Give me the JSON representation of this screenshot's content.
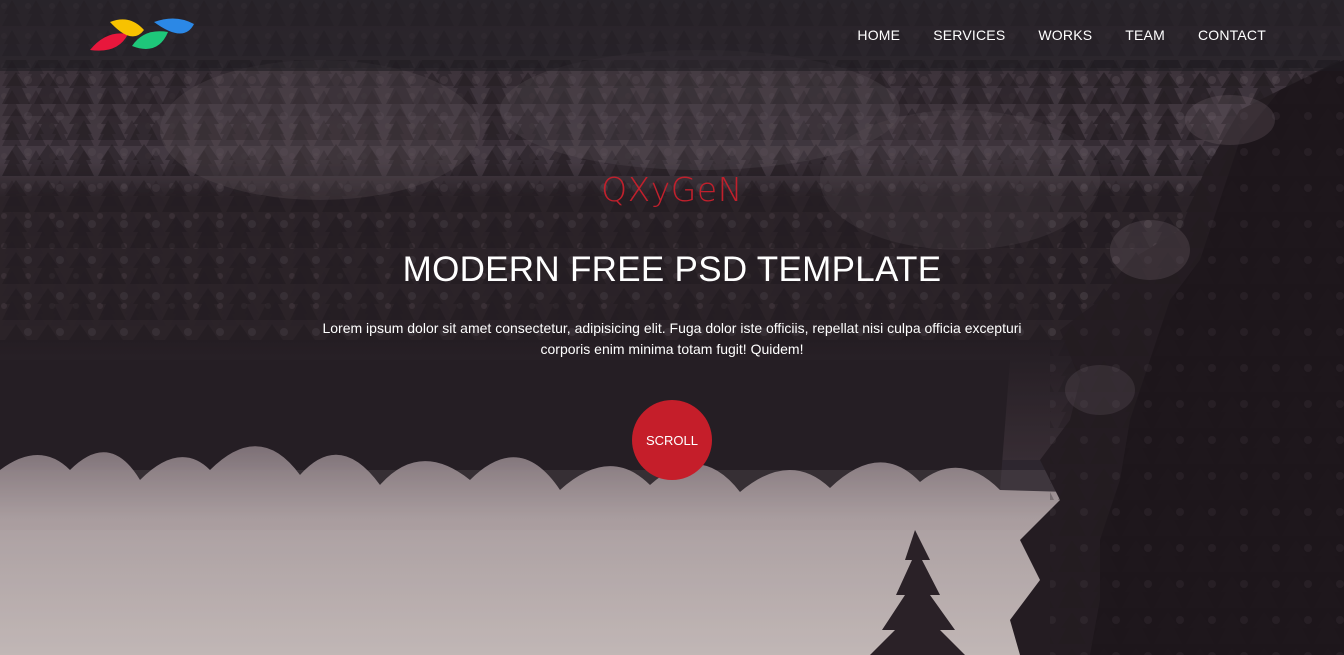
{
  "brand": {
    "name": "QXyGeN",
    "logo_icon": "colorful-leaves-logo-icon",
    "logo_colors": [
      "#e8173c",
      "#f7c200",
      "#1ec77a",
      "#2b88e6"
    ],
    "name_color": "#c1202c"
  },
  "nav": {
    "items": [
      {
        "label": "HOME"
      },
      {
        "label": "SERVICES"
      },
      {
        "label": "WORKS"
      },
      {
        "label": "TEAM"
      },
      {
        "label": "CONTACT"
      }
    ]
  },
  "hero": {
    "headline": "MODERN FREE PSD TEMPLATE",
    "subtext": "Lorem ipsum dolor sit amet consectetur, adipisicing elit. Fuga dolor iste officiis, repellat nisi culpa officia excepturi corporis enim minima totam fugit! Quidem!",
    "scroll_label": "SCROLL",
    "scroll_color": "#c51e2a",
    "background_image": "forest-lake-reflection-photo"
  }
}
